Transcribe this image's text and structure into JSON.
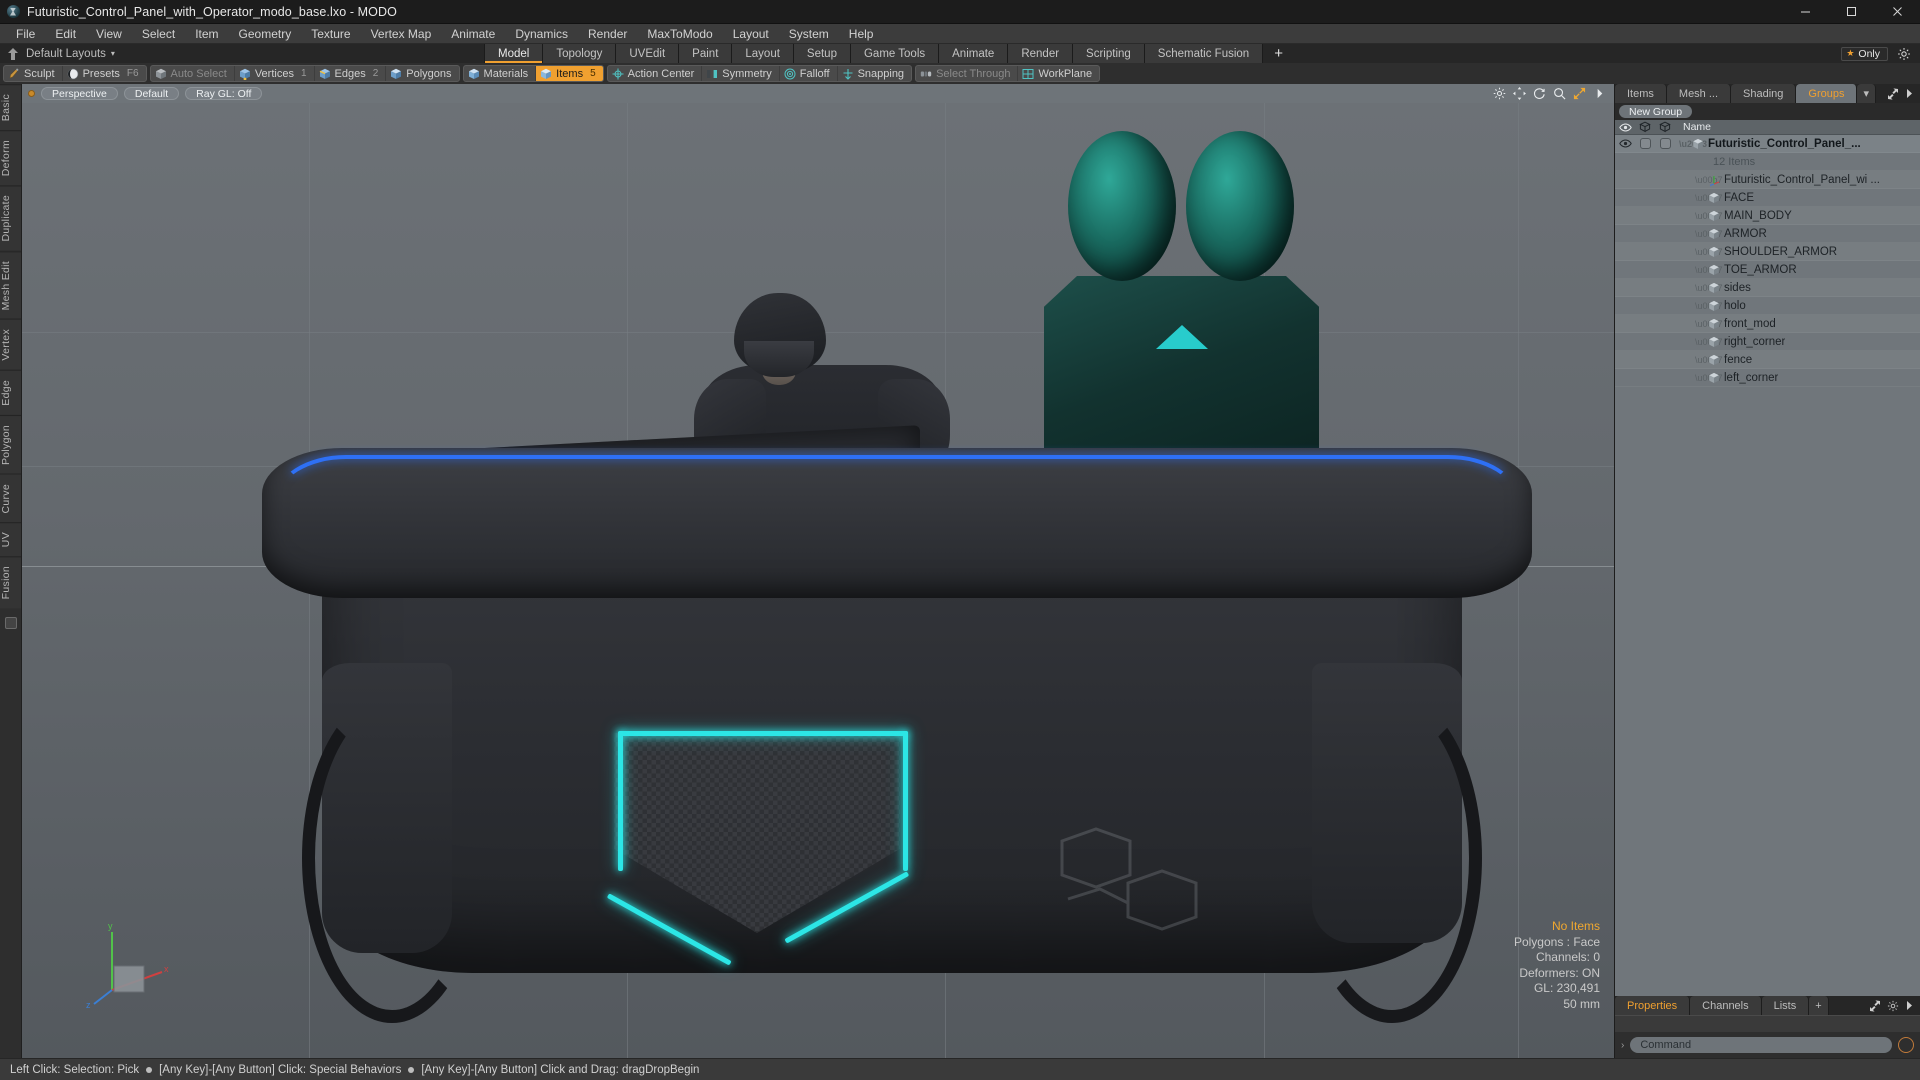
{
  "window": {
    "title": "Futuristic_Control_Panel_with_Operator_modo_base.lxo - MODO",
    "app_icon": "modo-icon",
    "minimize": "minimize-icon",
    "maximize": "maximize-icon",
    "close": "close-icon"
  },
  "menubar": {
    "items": [
      {
        "label": "File"
      },
      {
        "label": "Edit"
      },
      {
        "label": "View"
      },
      {
        "label": "Select"
      },
      {
        "label": "Item"
      },
      {
        "label": "Geometry"
      },
      {
        "label": "Texture"
      },
      {
        "label": "Vertex Map"
      },
      {
        "label": "Animate"
      },
      {
        "label": "Dynamics"
      },
      {
        "label": "Render"
      },
      {
        "label": "MaxToModo"
      },
      {
        "label": "Layout"
      },
      {
        "label": "System"
      },
      {
        "label": "Help"
      }
    ]
  },
  "layoutbar": {
    "pin_icon": "pin-icon",
    "preset_label": "Default Layouts",
    "caret": "▾",
    "tabs": [
      {
        "label": "Model",
        "active": true
      },
      {
        "label": "Topology",
        "active": false
      },
      {
        "label": "UVEdit",
        "active": false
      },
      {
        "label": "Paint",
        "active": false
      },
      {
        "label": "Layout",
        "active": false
      },
      {
        "label": "Setup",
        "active": false
      },
      {
        "label": "Game Tools",
        "active": false
      },
      {
        "label": "Animate",
        "active": false
      },
      {
        "label": "Render",
        "active": false
      },
      {
        "label": "Scripting",
        "active": false
      },
      {
        "label": "Schematic Fusion",
        "active": false
      }
    ],
    "add_tab": "+",
    "only_star": "★",
    "only_label": "Only",
    "gear_icon": "gear-icon"
  },
  "toolbar": {
    "groups": [
      {
        "buttons": [
          {
            "label": "Sculpt",
            "icon": "brush-icon",
            "num": "",
            "state": "normal"
          },
          {
            "label": "Presets",
            "icon": "sphere-icon",
            "num": "F6",
            "state": "normal"
          }
        ]
      },
      {
        "buttons": [
          {
            "label": "Auto Select",
            "icon": "cube-gray-icon",
            "num": "",
            "state": "dim"
          },
          {
            "label": "Vertices",
            "icon": "cube-vertex-icon",
            "num": "1",
            "state": "normal"
          },
          {
            "label": "Edges",
            "icon": "cube-edge-icon",
            "num": "2",
            "state": "normal"
          },
          {
            "label": "Polygons",
            "icon": "cube-poly-icon",
            "num": "",
            "state": "normal"
          }
        ]
      },
      {
        "buttons": [
          {
            "label": "Materials",
            "icon": "cube-material-icon",
            "num": "",
            "state": "normal"
          },
          {
            "label": "Items",
            "icon": "cube-item-icon",
            "num": "5",
            "state": "selected"
          }
        ]
      },
      {
        "buttons": [
          {
            "label": "Action Center",
            "icon": "action-center-icon",
            "num": "",
            "state": "normal"
          },
          {
            "label": "Symmetry",
            "icon": "symmetry-icon",
            "num": "",
            "state": "normal"
          },
          {
            "label": "Falloff",
            "icon": "falloff-icon",
            "num": "",
            "state": "normal"
          },
          {
            "label": "Snapping",
            "icon": "snapping-icon",
            "num": "",
            "state": "normal"
          }
        ]
      },
      {
        "buttons": [
          {
            "label": "Select Through",
            "icon": "select-through-icon",
            "num": "",
            "state": "dim"
          },
          {
            "label": "WorkPlane",
            "icon": "workplane-icon",
            "num": "",
            "state": "normal"
          }
        ]
      }
    ]
  },
  "left_rail": {
    "tabs": [
      "Basic",
      "Deform",
      "Duplicate",
      "Mesh Edit",
      "Vertex",
      "Edge",
      "Polygon",
      "Curve",
      "UV",
      "Fusion"
    ],
    "square_icon": "square-icon"
  },
  "viewport": {
    "dot_icon": "viewport-state-dot",
    "pills": [
      {
        "label": "Perspective"
      },
      {
        "label": "Default"
      },
      {
        "label": "Ray GL: Off"
      }
    ],
    "icons": [
      "settings-icon",
      "refresh-icon",
      "search-icon",
      "expand-icon",
      "chevron-right-icon"
    ],
    "gizmo_axes": [
      "y",
      "x",
      "z"
    ],
    "stats": {
      "selection": "No Items",
      "polygons": "Polygons : Face",
      "channels": "Channels: 0",
      "deformers": "Deformers: ON",
      "gl": "GL: 230,491",
      "scale": "50 mm"
    }
  },
  "right_panel": {
    "tabs": [
      {
        "label": "Items",
        "active": false
      },
      {
        "label": "Mesh ...",
        "active": false
      },
      {
        "label": "Shading",
        "active": false
      },
      {
        "label": "Groups",
        "active": true
      }
    ],
    "tab_caret": "▾",
    "tools": [
      "collapse-icon",
      "chevron-right-icon"
    ],
    "new_group_label": "New Group",
    "tree_header": {
      "col_visible": "eye-column-icon",
      "col_render": "render-column-icon",
      "col_shaded": "shaded-column-icon",
      "name": "Name"
    },
    "tree_items": [
      {
        "label": "Futuristic_Control_Panel_...",
        "icon": "group-cube-icon",
        "depth": 0,
        "style": "bold",
        "selected": true
      },
      {
        "label": "12 Items",
        "icon": "",
        "depth": 1,
        "style": "sub",
        "selected": false
      },
      {
        "label": "Futuristic_Control_Panel_wi ...",
        "icon": "locator-icon",
        "depth": 1,
        "style": "normal",
        "selected": false
      },
      {
        "label": "FACE",
        "icon": "mesh-cube-icon",
        "depth": 1,
        "style": "normal",
        "selected": false
      },
      {
        "label": "MAIN_BODY",
        "icon": "mesh-cube-icon",
        "depth": 1,
        "style": "normal",
        "selected": false
      },
      {
        "label": "ARMOR",
        "icon": "mesh-cube-icon",
        "depth": 1,
        "style": "normal",
        "selected": false
      },
      {
        "label": "SHOULDER_ARMOR",
        "icon": "mesh-cube-icon",
        "depth": 1,
        "style": "normal",
        "selected": false
      },
      {
        "label": "TOE_ARMOR",
        "icon": "mesh-cube-icon",
        "depth": 1,
        "style": "normal",
        "selected": false
      },
      {
        "label": "sides",
        "icon": "mesh-cube-icon",
        "depth": 1,
        "style": "normal",
        "selected": false
      },
      {
        "label": "holo",
        "icon": "mesh-cube-icon",
        "depth": 1,
        "style": "normal",
        "selected": false
      },
      {
        "label": "front_mod",
        "icon": "mesh-cube-icon",
        "depth": 1,
        "style": "normal",
        "selected": false
      },
      {
        "label": "right_corner",
        "icon": "mesh-cube-icon",
        "depth": 1,
        "style": "normal",
        "selected": false
      },
      {
        "label": "fence",
        "icon": "mesh-cube-icon",
        "depth": 1,
        "style": "normal",
        "selected": false
      },
      {
        "label": "left_corner",
        "icon": "mesh-cube-icon",
        "depth": 1,
        "style": "normal",
        "selected": false
      }
    ],
    "props_tabs": [
      {
        "label": "Properties",
        "active": true
      },
      {
        "label": "Channels",
        "active": false
      },
      {
        "label": "Lists",
        "active": false
      },
      {
        "label": "+",
        "active": false
      }
    ],
    "props_tools": [
      "expand-icon",
      "gear-icon",
      "chevron-right-icon"
    ],
    "command": {
      "caret": "›",
      "placeholder": "Command",
      "record_icon": "record-circle-icon"
    }
  },
  "statusbar": {
    "part1": "Left Click: Selection: Pick",
    "part2": "[Any Key]-[Any Button] Click: Special Behaviors",
    "part3": "[Any Key]-[Any Button] Click and Drag: dragDropBegin"
  },
  "colors": {
    "accent_orange": "#f0a030",
    "holo_cyan": "#2ce6e6",
    "rim_blue": "#2e73ff",
    "panel_bg": "#2e2e2e",
    "viewport_bg": "#64696e"
  }
}
